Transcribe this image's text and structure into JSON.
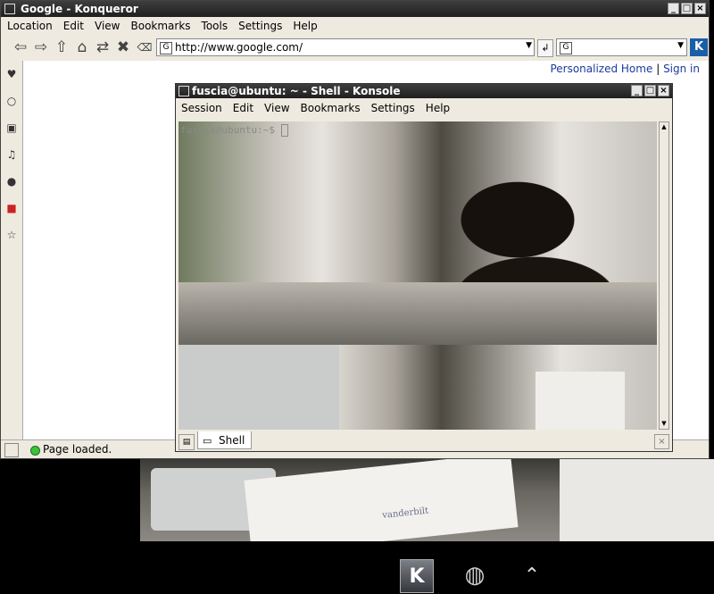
{
  "konqueror": {
    "title": "Google - Konqueror",
    "menu": [
      "Location",
      "Edit",
      "View",
      "Bookmarks",
      "Tools",
      "Settings",
      "Help"
    ],
    "url": "http://www.google.com/",
    "search_engine_glyph": "G",
    "links": {
      "personalized": "Personalized Home",
      "separator": "|",
      "signin": "Sign in"
    },
    "status": "Page loaded.",
    "logo_glyph": "K"
  },
  "konsole": {
    "title": "fuscia@ubuntu: ~ - Shell - Konsole",
    "menu": [
      "Session",
      "Edit",
      "View",
      "Bookmarks",
      "Settings",
      "Help"
    ],
    "prompt": "fuscia@ubuntu:~$",
    "tab_label": "Shell"
  },
  "desktop": {
    "note_text": "vanderbilt"
  }
}
